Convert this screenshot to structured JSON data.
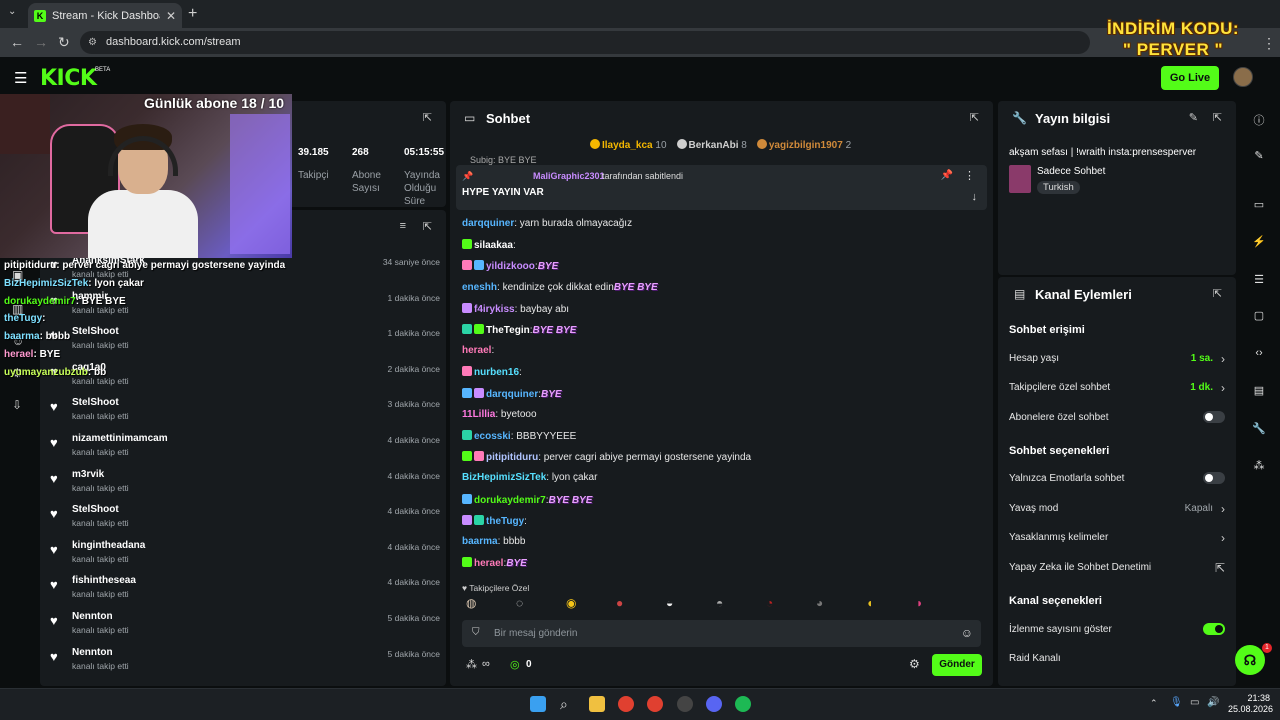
{
  "browser": {
    "tab_title": "Stream - Kick Dashboard",
    "url": "dashboard.kick.com/stream",
    "promo_line1": "İNDİRİM KODU:",
    "promo_line2": "\" PERVER \""
  },
  "header": {
    "logo": "KICK",
    "beta": "BETA",
    "go_live": "Go Live"
  },
  "overlay": {
    "sub_goal": "Günlük abone 18 / 10",
    "chat": [
      {
        "user": "pitipitiduru",
        "text": ": perver cagri abiye permayi gostersene yayinda",
        "color": "#ffffff"
      },
      {
        "user": "BizHepimizSizTek",
        "text": ": lyon çakar",
        "color": "#7ee0ff"
      },
      {
        "user": "dorukaydemir7",
        "text": ": BYE BYE",
        "color": "#53fc18"
      },
      {
        "user": "theTugy",
        "text": ":",
        "color": "#7ee0ff"
      },
      {
        "user": "baarma",
        "text": ": bbbb",
        "color": "#7ee0ff"
      },
      {
        "user": "herael",
        "text": ": BYE",
        "color": "#ff9ad0"
      },
      {
        "user": "uyumayanzubzub",
        "text": ": bb",
        "color": "#c8ff5a"
      }
    ]
  },
  "stats": {
    "followers_value": "39.185",
    "followers_label": "Takipçi",
    "subs_value": "268",
    "subs_label1": "Abone",
    "subs_label2": "Sayısı",
    "uptime_value": "05:15:55",
    "uptime_label1": "Yayında",
    "uptime_label2": "Olduğu",
    "uptime_label3": "Süre"
  },
  "feed": {
    "items": [
      {
        "name": "AnanksimStark",
        "sub": "kanalı takip etti",
        "time": "34 saniye önce"
      },
      {
        "name": "hammir",
        "sub": "kanalı takip etti",
        "time": "1 dakika önce"
      },
      {
        "name": "StelShoot",
        "sub": "kanalı takip etti",
        "time": "1 dakika önce"
      },
      {
        "name": "cag1a0",
        "sub": "kanalı takip etti",
        "time": "2 dakika önce"
      },
      {
        "name": "StelShoot",
        "sub": "kanalı takip etti",
        "time": "3 dakika önce"
      },
      {
        "name": "nizamettinimamcam",
        "sub": "kanalı takip etti",
        "time": "4 dakika önce"
      },
      {
        "name": "m3rvik",
        "sub": "kanalı takip etti",
        "time": "4 dakika önce"
      },
      {
        "name": "StelShoot",
        "sub": "kanalı takip etti",
        "time": "4 dakika önce"
      },
      {
        "name": "kingintheadana",
        "sub": "kanalı takip etti",
        "time": "4 dakika önce"
      },
      {
        "name": "fishintheseaa",
        "sub": "kanalı takip etti",
        "time": "4 dakika önce"
      },
      {
        "name": "Nennton",
        "sub": "kanalı takip etti",
        "time": "5 dakika önce"
      },
      {
        "name": "Nennton",
        "sub": "kanalı takip etti",
        "time": "5 dakika önce"
      }
    ]
  },
  "chat": {
    "title": "Sohbet",
    "top_gifters": [
      {
        "name": "Ilayda_kca",
        "count": "10"
      },
      {
        "name": "BerkanAbi",
        "count": "8"
      },
      {
        "name": "yagizbilgin1907",
        "count": "2"
      }
    ],
    "peek": "Subig: BYE BYE",
    "pinned_by_user": "MaliGraphic2301",
    "pinned_by_suffix": "tarafından sabitlendi",
    "pinned_text": "HYPE YAYIN VAR",
    "messages": [
      {
        "user": "darqquiner",
        "color": "#57b6ff",
        "text": ": yarn burada olmayacağız"
      },
      {
        "user": "silaakaa",
        "color": "#ffffff",
        "text": ":"
      },
      {
        "user": "yildizkooo",
        "color": "#c88cff",
        "text": ":",
        "emote": "BYE"
      },
      {
        "user": "eneshh",
        "color": "#57b6ff",
        "text": ": kendinize çok dikkat edin",
        "emote": "BYE BYE"
      },
      {
        "user": "f4irykiss",
        "color": "#c88cff",
        "text": ": baybay abı"
      },
      {
        "user": "TheTegin",
        "color": "#ffffff",
        "text": ":",
        "emote": "BYE BYE"
      },
      {
        "user": "herael",
        "color": "#ff7ab8",
        "text": ":"
      },
      {
        "user": "nurben16",
        "color": "#57e0ff",
        "text": ":"
      },
      {
        "user": "darqquiner",
        "color": "#57b6ff",
        "text": ":",
        "emote": "BYE"
      },
      {
        "user": "11Lillia",
        "color": "#ff7ae0",
        "text": ": byetooo"
      },
      {
        "user": "ecosski",
        "color": "#57b6ff",
        "text": ": BBBYYYEEE"
      },
      {
        "user": "pitipitiduru",
        "color": "#b0c4ff",
        "text": ": perver cagri abiye permayi gostersene yayinda"
      },
      {
        "user": "BizHepimizSizTek",
        "color": "#57e0ff",
        "text": ": lyon çakar"
      },
      {
        "user": "dorukaydemir7",
        "color": "#53fc18",
        "text": ":",
        "emote": "BYE BYE"
      },
      {
        "user": "theTugy",
        "color": "#57b6ff",
        "text": ":"
      },
      {
        "user": "baarma",
        "color": "#57b6ff",
        "text": ": bbbb"
      },
      {
        "user": "herael",
        "color": "#ff7ab8",
        "text": ":",
        "emote": "BYE"
      }
    ],
    "followers_only": "Takipçilere Özel",
    "input_placeholder": "Bir mesaj gönderin",
    "points": "0",
    "send": "Gönder"
  },
  "stream_info": {
    "title": "Yayın bilgisi",
    "stream_title": "akşam sefası | !wraith insta:prensesperver",
    "category": "Sadece Sohbet",
    "tag": "Turkish"
  },
  "channel_actions": {
    "title": "Kanal Eylemleri",
    "chat_access": "Sohbet erişimi",
    "account_age": "Hesap yaşı",
    "account_age_val": "1 sa.",
    "followers_chat": "Takipçilere özel sohbet",
    "followers_chat_val": "1 dk.",
    "subs_chat": "Abonelere özel sohbet",
    "chat_options": "Sohbet seçenekleri",
    "emote_only": "Yalnızca Emotlarla sohbet",
    "slow_mode": "Yavaş mod",
    "slow_mode_val": "Kapalı",
    "banned_words": "Yasaklanmış kelimeler",
    "ai_moderation": "Yapay Zeka ile Sohbet Denetimi",
    "channel_options": "Kanal seçenekleri",
    "show_viewers": "İzlenme sayısını göster",
    "raid": "Raid Kanalı"
  },
  "taskbar": {
    "time": "21:38",
    "date": "25.08.2026"
  },
  "colors": {
    "accent": "#53fc18",
    "panel": "#171b1e",
    "background": "#0b0e0f"
  }
}
